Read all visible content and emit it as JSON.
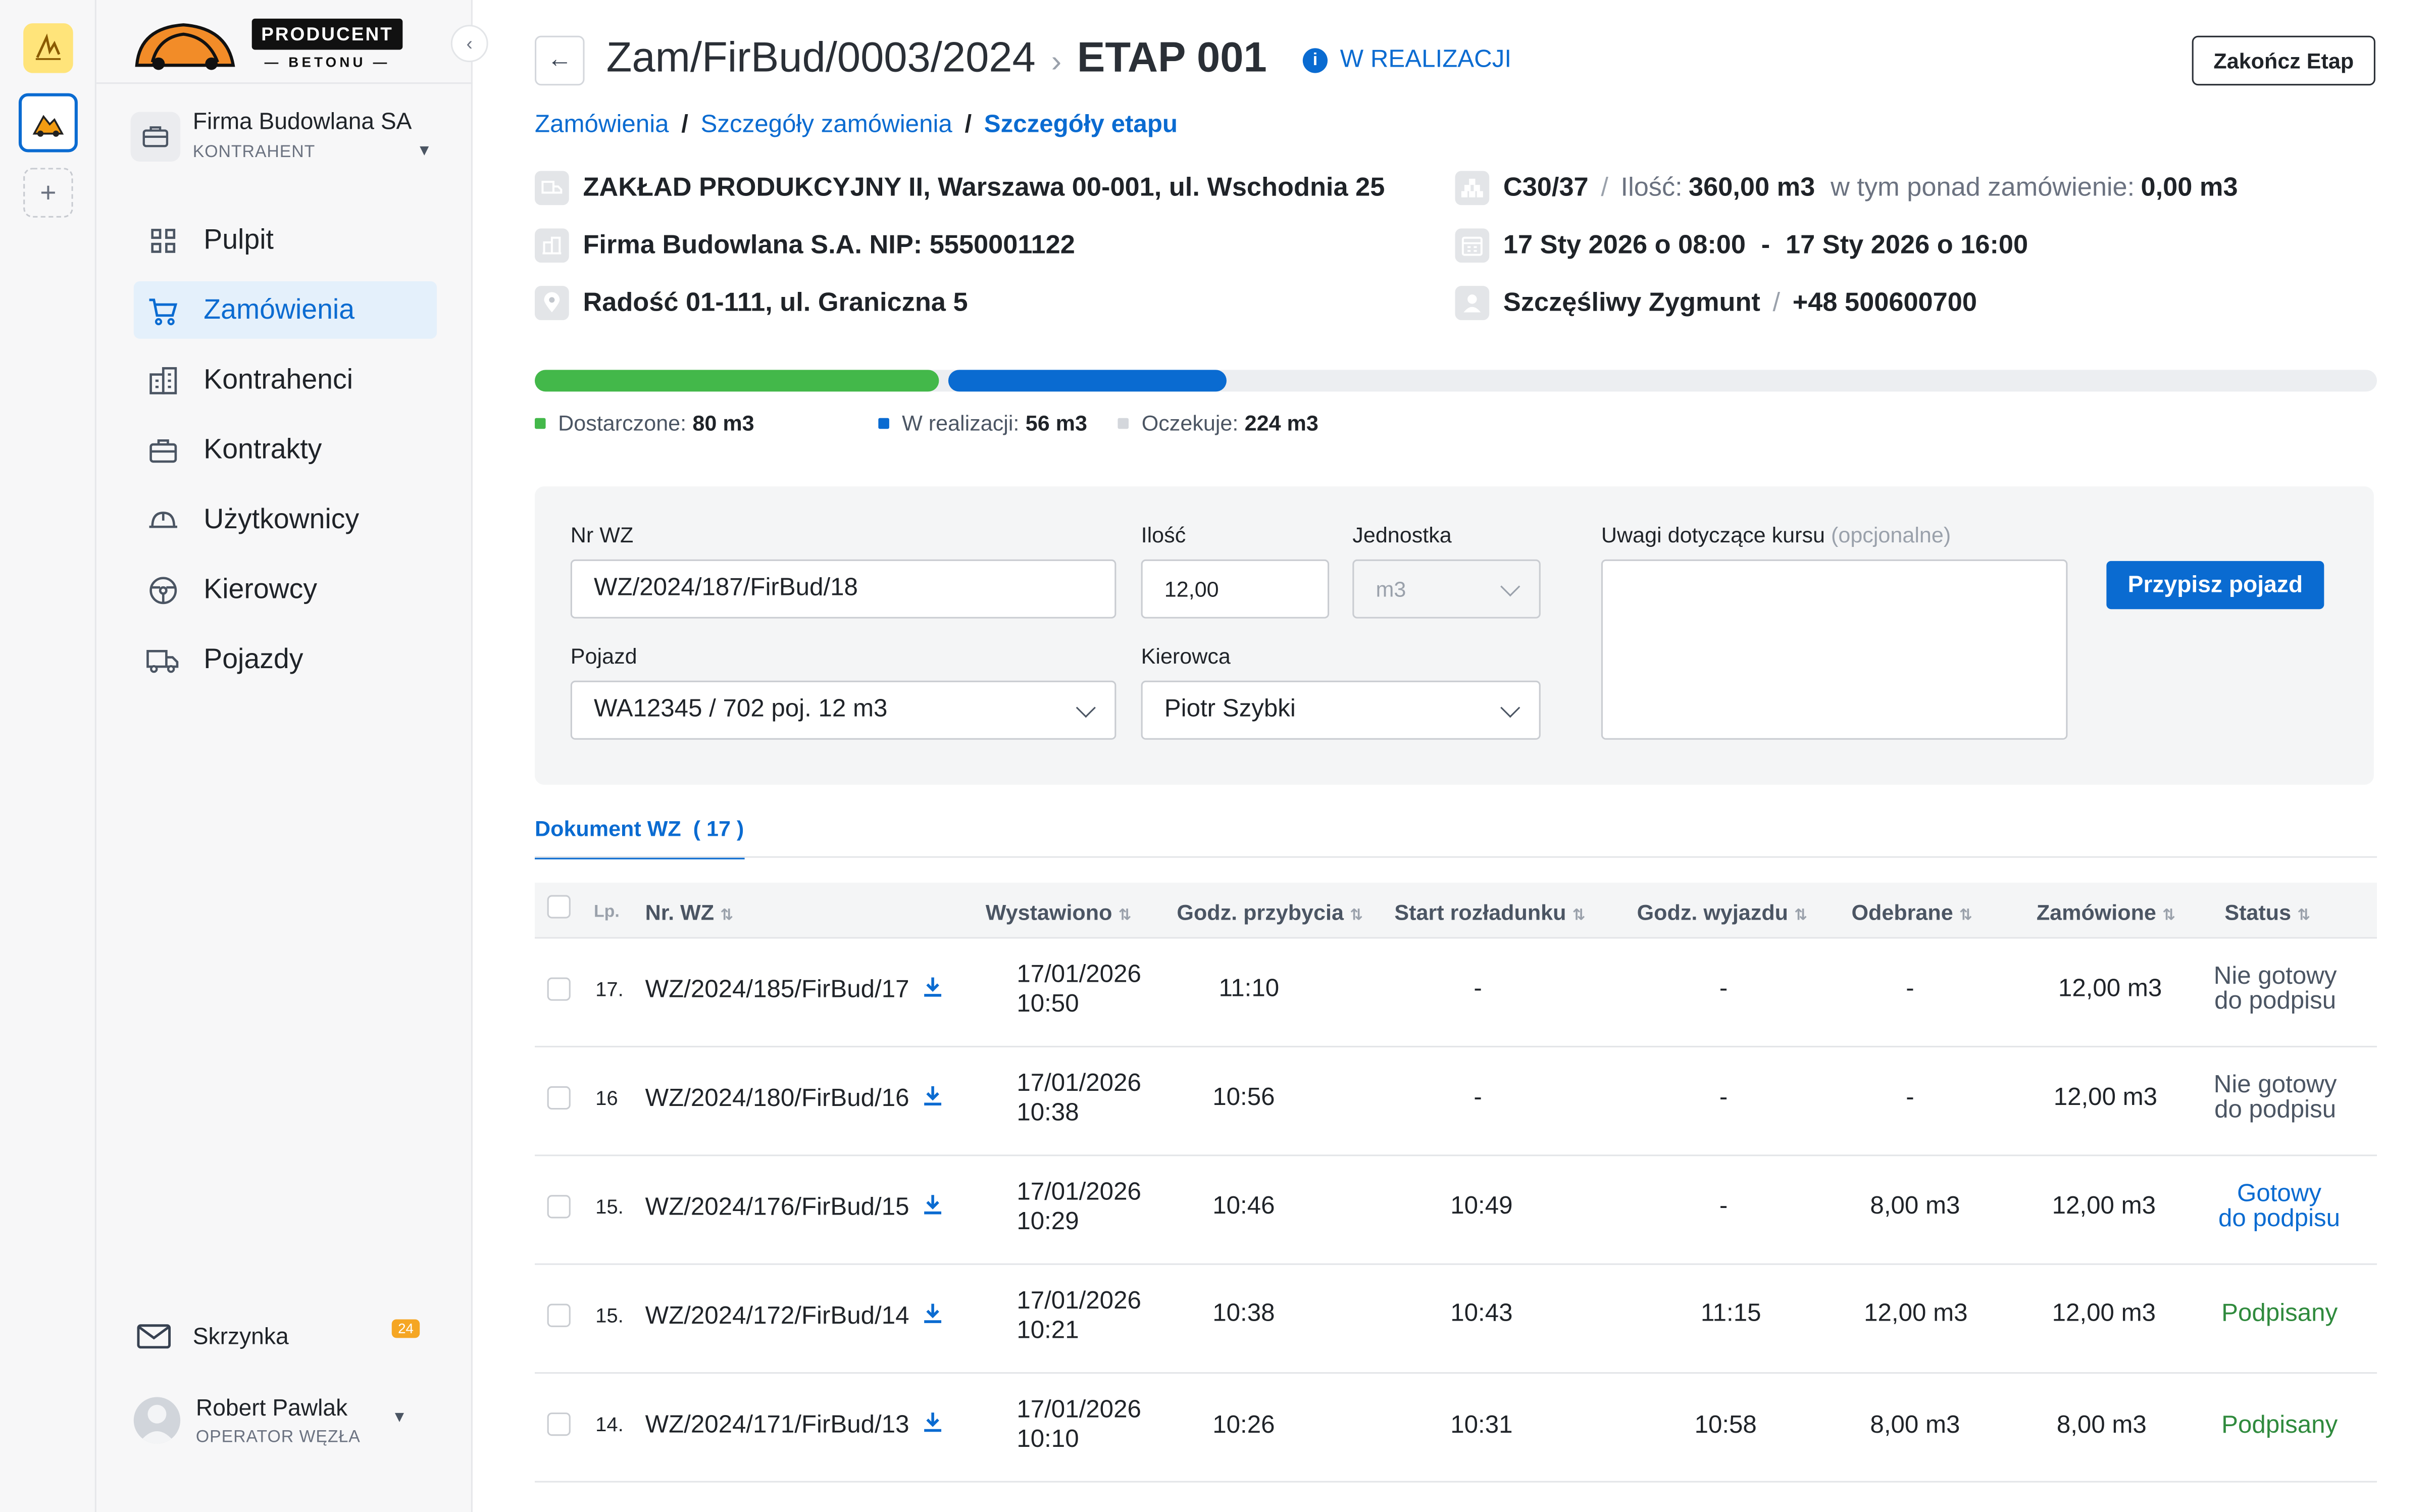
{
  "brand": {
    "name": "PRODUCENT",
    "sub": "— BETONU —"
  },
  "company": {
    "name": "Firma Budowlana SA",
    "role": "KONTRAHENT"
  },
  "nav": [
    {
      "label": "Pulpit",
      "icon": "grid-icon"
    },
    {
      "label": "Zamówienia",
      "icon": "cart-icon",
      "active": true
    },
    {
      "label": "Kontrahenci",
      "icon": "building-icon"
    },
    {
      "label": "Kontrakty",
      "icon": "briefcase-icon"
    },
    {
      "label": "Użytkownicy",
      "icon": "helmet-icon"
    },
    {
      "label": "Kierowcy",
      "icon": "steering-wheel-icon"
    },
    {
      "label": "Pojazdy",
      "icon": "truck-icon"
    }
  ],
  "inbox": {
    "label": "Skrzynka",
    "count": "24"
  },
  "user": {
    "name": "Robert Pawlak",
    "role": "OPERATOR WĘZŁA"
  },
  "header": {
    "order": "Zam/FirBud/0003/2024",
    "stage": "ETAP 001",
    "status": "W REALIZACJI",
    "finish_label": "Zakończ Etap"
  },
  "breadcrumb": [
    "Zamówienia",
    "Szczegóły zamówienia",
    "Szczegóły etapu"
  ],
  "info": {
    "plant": "ZAKŁAD PRODUKCYJNY II, Warszawa 00-001, ul. Wschodnia 25",
    "client": "Firma Budowlana S.A. NIP: 5550001122",
    "site": "Radość 01-111, ul. Graniczna 5",
    "grade": "C30/37",
    "qty_label": "Ilość:",
    "qty": "360,00 m3",
    "extra_label": "w tym ponad zamówienie:",
    "extra": "0,00 m3",
    "from": "17 Sty 2026 o 08:00",
    "dash": "-",
    "to": "17 Sty 2026 o 16:00",
    "contact": "Szczęśliwy Zygmunt",
    "phone": "+48 500600700"
  },
  "progress": {
    "total": 360,
    "delivered": 80,
    "in_progress": 56,
    "waiting": 224,
    "colors": {
      "delivered": "#43b84a",
      "in_progress": "#0a6bd1",
      "waiting": "#eceef1"
    },
    "legend": [
      {
        "label": "Dostarczone:",
        "value": "80 m3",
        "color": "#43b84a"
      },
      {
        "label": "W realizacji:",
        "value": "56 m3",
        "color": "#0a6bd1"
      },
      {
        "label": "Oczekuje:",
        "value": "224 m3",
        "color": "#d4d7dc"
      }
    ]
  },
  "form": {
    "nr_wz_label": "Nr WZ",
    "nr_wz": "WZ/2024/187/FirBud/18",
    "qty_label": "Ilość",
    "qty": "12,00",
    "unit_label": "Jednostka",
    "unit": "m3",
    "notes_label": "Uwagi dotyczące kursu",
    "notes_optional": "(opcjonalne)",
    "vehicle_label": "Pojazd",
    "vehicle": "WA12345 / 702 poj. 12 m3",
    "driver_label": "Kierowca",
    "driver": "Piotr Szybki",
    "assign_label": "Przypisz pojazd"
  },
  "tab": {
    "label": "Dokument WZ",
    "count": "( 17 )"
  },
  "table": {
    "headers": [
      "Lp.",
      "Nr. WZ",
      "Wystawiono",
      "Godz. przybycia",
      "Start rozładunku",
      "Godz. wyjazdu",
      "Odebrane",
      "Zamówione",
      "Status"
    ],
    "rows": [
      {
        "lp": "17.",
        "wz": "WZ/2024/185/FirBud/17",
        "date": "17/01/2026",
        "time": "10:50",
        "arrival": "11:10",
        "unload": "-",
        "depart": "-",
        "received": "-",
        "ordered": "12,00 m3",
        "status1": "Nie gotowy",
        "status2": "do podpisu",
        "kind": "pending"
      },
      {
        "lp": "16",
        "wz": "WZ/2024/180/FirBud/16",
        "date": "17/01/2026",
        "time": "10:38",
        "arrival": "10:56",
        "unload": "-",
        "depart": "-",
        "received": "-",
        "ordered": "12,00 m3",
        "status1": "Nie gotowy",
        "status2": "do podpisu",
        "kind": "pending"
      },
      {
        "lp": "15.",
        "wz": "WZ/2024/176/FirBud/15",
        "date": "17/01/2026",
        "time": "10:29",
        "arrival": "10:46",
        "unload": "10:49",
        "depart": "-",
        "received": "8,00 m3",
        "ordered": "12,00 m3",
        "status1": "Gotowy",
        "status2": "do podpisu",
        "kind": "ready"
      },
      {
        "lp": "15.",
        "wz": "WZ/2024/172/FirBud/14",
        "date": "17/01/2026",
        "time": "10:21",
        "arrival": "10:38",
        "unload": "10:43",
        "depart": "11:15",
        "received": "12,00 m3",
        "ordered": "12,00 m3",
        "status1": "Podpisany",
        "status2": "",
        "kind": "signed"
      },
      {
        "lp": "14.",
        "wz": "WZ/2024/171/FirBud/13",
        "date": "17/01/2026",
        "time": "10:10",
        "arrival": "10:26",
        "unload": "10:31",
        "depart": "10:58",
        "received": "8,00 m3",
        "ordered": "8,00 m3",
        "status1": "Podpisany",
        "status2": "",
        "kind": "signed"
      }
    ]
  }
}
